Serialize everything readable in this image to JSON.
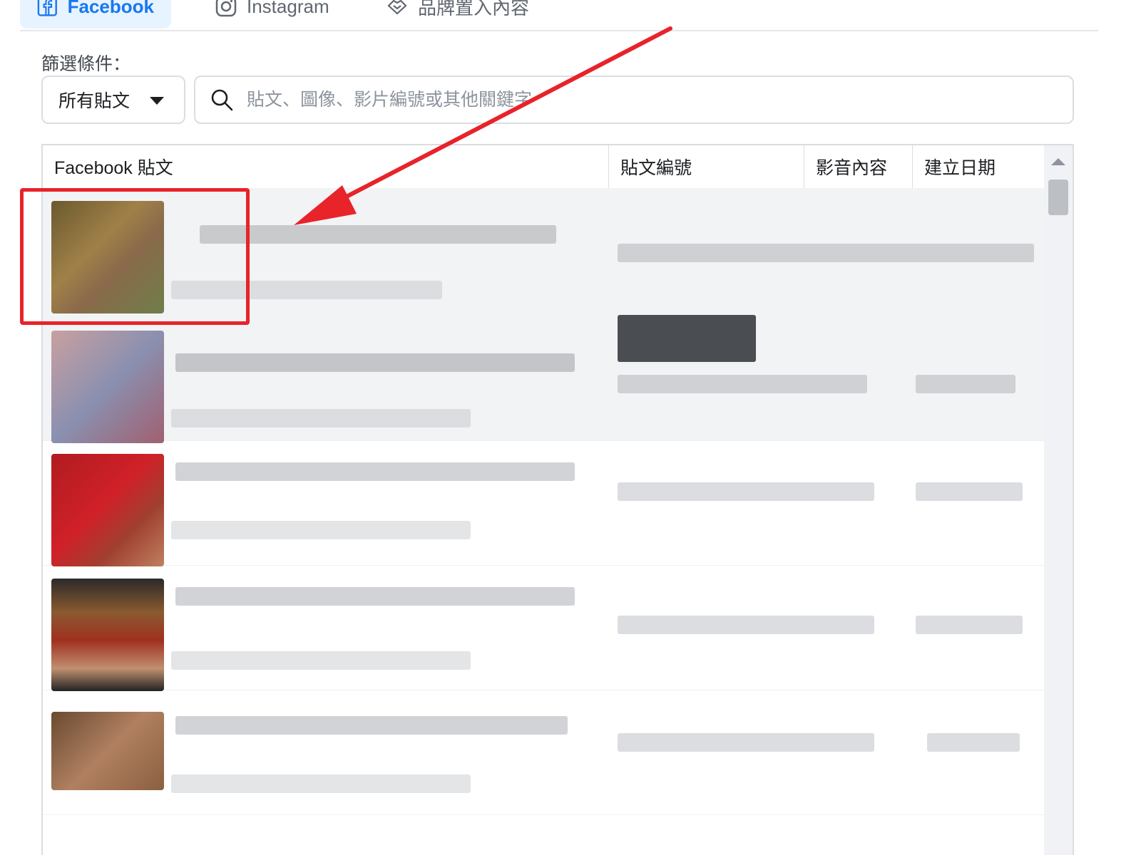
{
  "tabs": [
    {
      "label": "Facebook",
      "icon": "facebook-icon",
      "active": true
    },
    {
      "label": "Instagram",
      "icon": "instagram-icon",
      "active": false
    },
    {
      "label": "品牌置入內容",
      "icon": "handshake-icon",
      "active": false
    }
  ],
  "filter": {
    "label": "篩選條件：",
    "dropdown_value": "所有貼文",
    "search_placeholder": "貼文、圖像、影片編號或其他關鍵字"
  },
  "table": {
    "columns": [
      "Facebook 貼文",
      "貼文編號",
      "影音內容",
      "建立日期"
    ]
  },
  "colors": {
    "accent": "#1877f2",
    "annotation": "#e8232a"
  }
}
